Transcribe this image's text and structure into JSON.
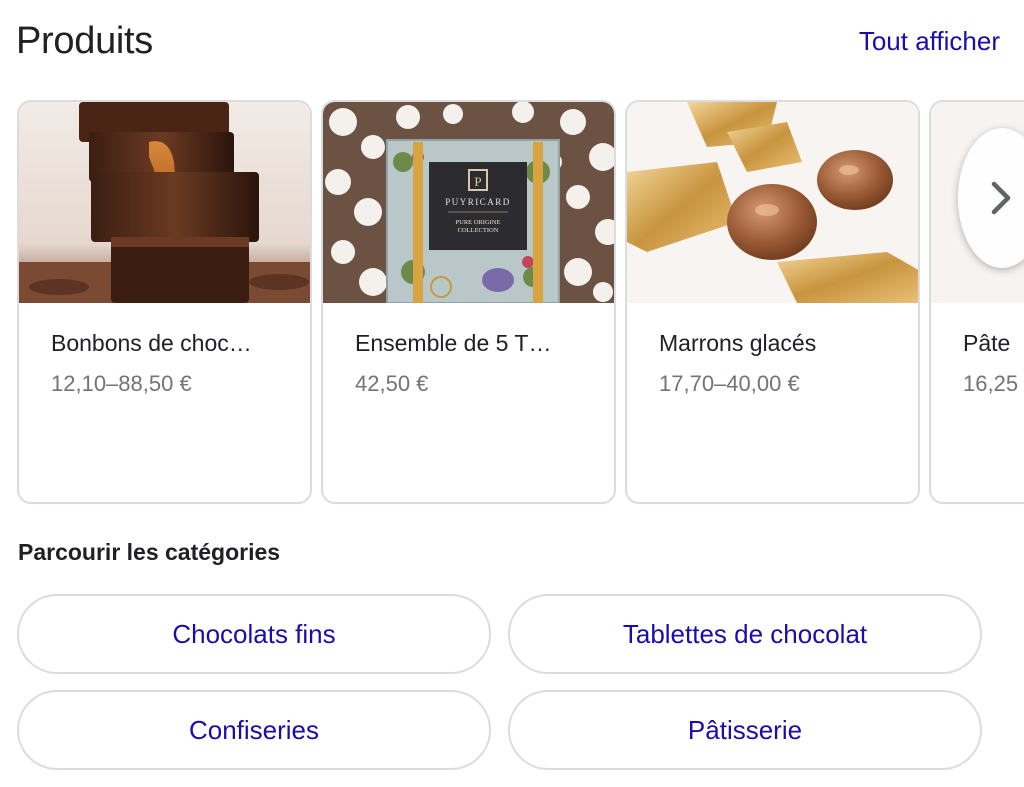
{
  "header": {
    "title": "Produits",
    "see_all": "Tout afficher"
  },
  "products": [
    {
      "name": "Bonbons de choc…",
      "price": "12,10–88,50 €"
    },
    {
      "name": "Ensemble de 5 T…",
      "price": "42,50 €"
    },
    {
      "name": "Marrons glacés",
      "price": "17,70–40,00 €"
    },
    {
      "name": "Pâte",
      "price": "16,25"
    }
  ],
  "product_image_text": {
    "brand": "PUYRICARD",
    "collection_line1": "PURE ORIGINE",
    "collection_line2": "COLLECTION"
  },
  "icons": {
    "next": "chevron-right-icon"
  },
  "categories": {
    "title": "Parcourir les catégories",
    "chips": [
      "Chocolats fins",
      "Tablettes de chocolat",
      "Confiseries",
      "Pâtisserie"
    ]
  },
  "colors": {
    "link": "#1a0dab",
    "price": "#70757a",
    "border": "#dadce0",
    "text": "#202124"
  }
}
